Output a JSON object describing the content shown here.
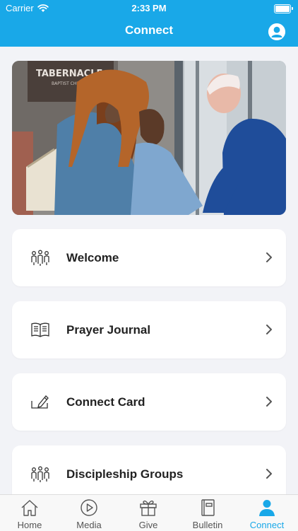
{
  "status_bar": {
    "carrier": "Carrier",
    "time": "2:33 PM"
  },
  "header": {
    "title": "Connect"
  },
  "hero": {
    "sign_main": "TABERNACLE",
    "sign_sub": "BAPTIST CHURCH"
  },
  "menu": [
    {
      "label": "Welcome",
      "icon": "people-group-icon"
    },
    {
      "label": "Prayer Journal",
      "icon": "open-book-icon"
    },
    {
      "label": "Connect Card",
      "icon": "edit-card-icon"
    },
    {
      "label": "Discipleship Groups",
      "icon": "people-group-icon"
    }
  ],
  "tabs": [
    {
      "label": "Home",
      "icon": "home-icon"
    },
    {
      "label": "Media",
      "icon": "play-circle-icon"
    },
    {
      "label": "Give",
      "icon": "gift-icon"
    },
    {
      "label": "Bulletin",
      "icon": "book-icon"
    },
    {
      "label": "Connect",
      "icon": "person-icon",
      "active": true
    }
  ],
  "colors": {
    "accent": "#19a8e8",
    "background": "#f2f3f7",
    "card": "#ffffff"
  }
}
